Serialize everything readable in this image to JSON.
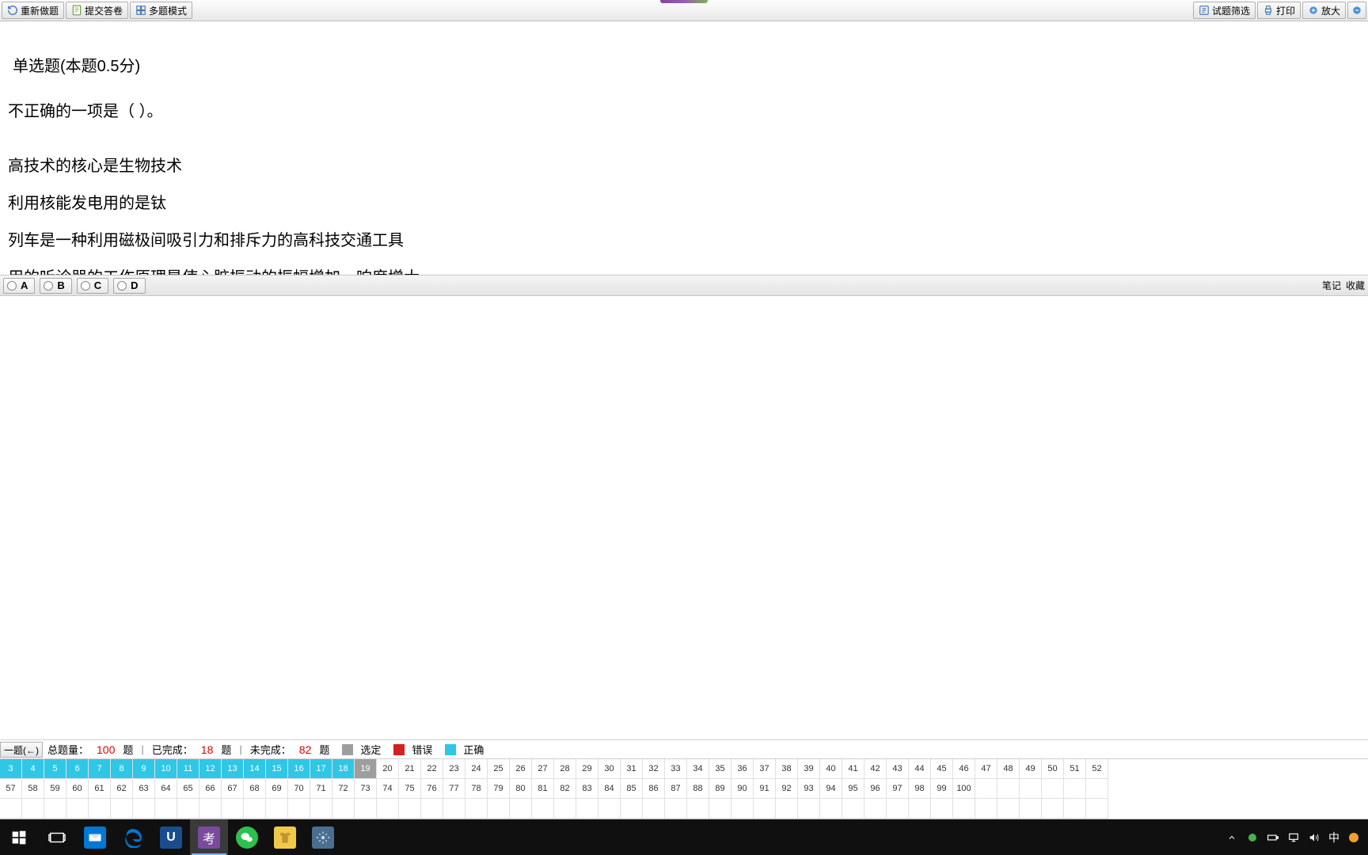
{
  "toolbar": {
    "redo": "重新做题",
    "submit": "提交答卷",
    "multi": "多题模式",
    "filter": "试题筛选",
    "print": "打印",
    "zoom": "放大"
  },
  "question": {
    "title": "单选题(本题0.5分)",
    "stem": "不正确的一项是（ ）。",
    "opts": {
      "a": "高技术的核心是生物技术",
      "b": "利用核能发电用的是钛",
      "c": "列车是一种利用磁极间吸引力和排斥力的高科技交通工具",
      "d": "用的听诊器的工作原理是使心脏振动的振幅增加，响度增大"
    }
  },
  "choices": {
    "a": "A",
    "b": "B",
    "c": "C",
    "d": "D"
  },
  "answerbar": {
    "note": "笔记",
    "fav": "收藏"
  },
  "status": {
    "prev": "一题(←)",
    "totalLabel": "总题量：",
    "totalNum": "100",
    "totalUnit": "题",
    "doneLabel": "已完成：",
    "doneNum": "18",
    "doneUnit": "题",
    "undoneLabel": "未完成：",
    "undoneNum": "82",
    "undoneUnit": "题",
    "selected": "选定",
    "wrong": "错误",
    "correct": "正确"
  },
  "nav": {
    "row1": [
      "3",
      "4",
      "5",
      "6",
      "7",
      "8",
      "9",
      "10",
      "11",
      "12",
      "13",
      "14",
      "15",
      "16",
      "17",
      "18",
      "19",
      "20",
      "21",
      "22",
      "23",
      "24",
      "25",
      "26",
      "27",
      "28",
      "29",
      "30",
      "31",
      "32",
      "33",
      "34",
      "35",
      "36",
      "37",
      "38",
      "39",
      "40",
      "41",
      "42",
      "43",
      "44",
      "45",
      "46",
      "47",
      "48",
      "49",
      "50",
      "51",
      "52"
    ],
    "row2": [
      "57",
      "58",
      "59",
      "60",
      "61",
      "62",
      "63",
      "64",
      "65",
      "66",
      "67",
      "68",
      "69",
      "70",
      "71",
      "72",
      "73",
      "74",
      "75",
      "76",
      "77",
      "78",
      "79",
      "80",
      "81",
      "82",
      "83",
      "84",
      "85",
      "86",
      "87",
      "88",
      "89",
      "90",
      "91",
      "92",
      "93",
      "94",
      "95",
      "96",
      "97",
      "98",
      "99",
      "100"
    ],
    "completed": 18,
    "current": 19
  },
  "tray": {
    "ime": "中"
  }
}
